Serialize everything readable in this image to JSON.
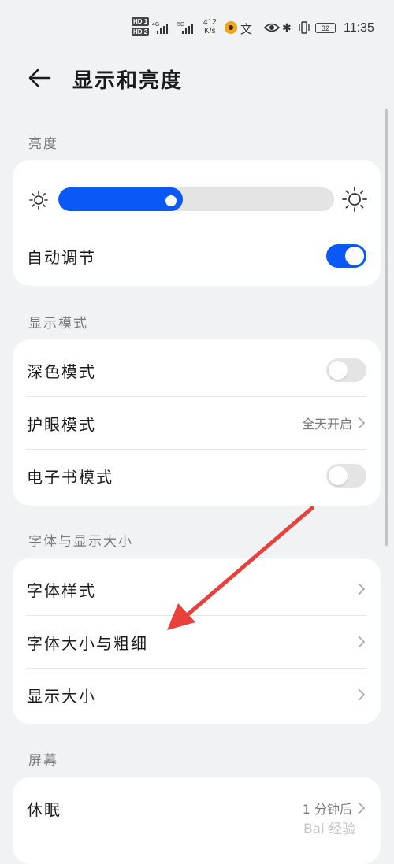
{
  "status_bar": {
    "hd1": "HD 1",
    "hd2": "HD 2",
    "sig1": "4G",
    "sig2": "5G",
    "net_speed_value": "412",
    "net_speed_unit": "K/s",
    "text_icon": "文",
    "battery": "32",
    "time": "11:35",
    "icons": [
      "hd-icon",
      "signal-icon",
      "app-icon",
      "eye-comfort-icon",
      "bluetooth-icon",
      "vibrate-icon",
      "battery-icon"
    ]
  },
  "header": {
    "title": "显示和亮度"
  },
  "brightness": {
    "section_title": "亮度",
    "level_fraction": 0.45,
    "auto_label": "自动调节",
    "auto_on": true
  },
  "display_mode": {
    "section_title": "显示模式",
    "dark_mode_label": "深色模式",
    "dark_mode_on": false,
    "eye_comfort_label": "护眼模式",
    "eye_comfort_value": "全天开启",
    "ebook_label": "电子书模式",
    "ebook_on": false
  },
  "font_display": {
    "section_title": "字体与显示大小",
    "font_style_label": "字体样式",
    "font_size_label": "字体大小与粗细",
    "display_size_label": "显示大小"
  },
  "screen": {
    "section_title": "屏幕",
    "sleep_label": "休眠",
    "sleep_value": "1 分钟后"
  },
  "colors": {
    "accent": "#0a59f7",
    "annotation_arrow": "#e8413c",
    "background": "#f1f2f4"
  },
  "watermark": "Bai 经验"
}
